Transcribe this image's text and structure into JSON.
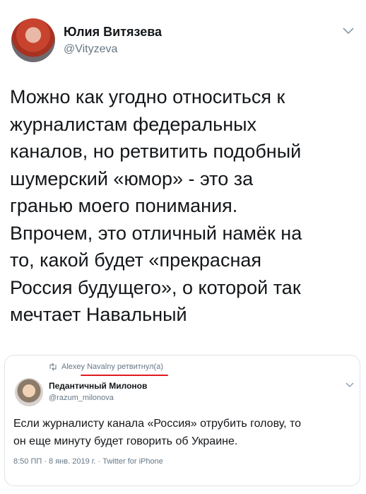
{
  "tweet": {
    "author_name": "Юлия Витязева",
    "author_handle": "@Vityzeva",
    "text_lines": [
      "Можно как угодно относиться к",
      "журналистам федеральных",
      "каналов, но ретвитить подобный",
      "шумерский «юмор» - это за",
      "гранью моего понимания.",
      "Впрочем, это отличный намёк на",
      "то, какой будет «прекрасная",
      "Россия будущего», о которой так",
      "мечтает Навальный"
    ]
  },
  "quoted": {
    "retweet_label": "Alexey Navalny ретвитнул(а)",
    "author_name": "Педантичный Милонов",
    "author_handle": "@razum_milonova",
    "text_lines": [
      "Если журналисту канала «Россия» отрубить голову, то",
      "он еще минуту будет говорить об Украине."
    ],
    "meta": "8:50 ПП · 8 янв. 2019 г. · Twitter for iPhone"
  },
  "colors": {
    "text": "#14171a",
    "secondary": "#657786",
    "underline_accent": "#e0191f",
    "border": "#dfe3e6"
  },
  "icons": [
    "chevron-down-icon",
    "retweet-icon"
  ]
}
